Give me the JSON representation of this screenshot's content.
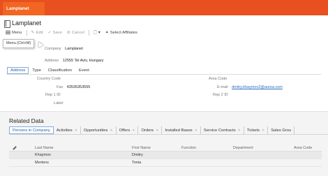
{
  "app": {
    "tab_label": "Lamplanet"
  },
  "header": {
    "title": "Lamplanet"
  },
  "toolbar": {
    "menu_label": "Menu",
    "edit_label": "Edit",
    "save_label": "Save",
    "cancel_label": "Cancel",
    "select_affiliates_label": "Select Affiliates",
    "menu_tooltip": "Menu (Ctrl+M)"
  },
  "form": {
    "company_label": "Company",
    "company_value": "Lamplanet",
    "address_label": "Address",
    "address_value": "12555 Tel Aviv, Hungary"
  },
  "subtabs": [
    "Address",
    "Type",
    "Classification",
    "Event"
  ],
  "details": {
    "country_code_label": "Country Code",
    "fax_label": "Fax",
    "fax_value": "43535353555",
    "rep1_label": "Rep 1 ID",
    "label_label": "Label",
    "area_code_label": "Area Code",
    "email_label": "E-mail",
    "email_value": "dmitry.khaymov2@aurea.com",
    "rep2_label": "Rep 2 ID"
  },
  "related": {
    "title": "Related Data",
    "tabs": [
      "Persons in Company",
      "Activities",
      "Opportunities",
      "Offers",
      "Orders",
      "Installed Bases",
      "Service Contracts",
      "Tickets",
      "Sales Grou"
    ]
  },
  "grid": {
    "columns": [
      "Last Name",
      "First Name",
      "Function",
      "Department",
      "Area Code"
    ],
    "rows": [
      {
        "last_name": "Khaymov",
        "first_name": "Dmitry"
      },
      {
        "last_name": "Mertens",
        "first_name": "Tonia"
      }
    ]
  },
  "colors": {
    "accent": "#e8501f",
    "tab": "#f26522",
    "link": "#2a6ebb"
  }
}
